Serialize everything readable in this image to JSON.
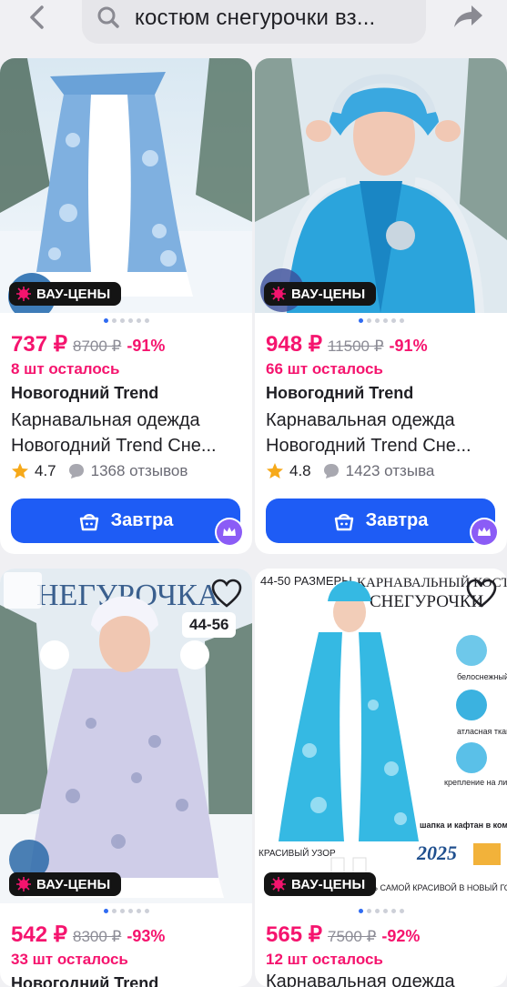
{
  "search": {
    "query": "костюм снегурочки вз..."
  },
  "badge_label": "ВАУ-ЦЕНЫ",
  "products": [
    {
      "price": "737 ₽",
      "old_price": "8700 ₽",
      "discount": "-91%",
      "stock": "8 шт осталось",
      "brand": "Новогодний Trend",
      "title_line1": "Карнавальная одежда",
      "title_line2": "Новогодний Trend Сне...",
      "rating": "4.7",
      "reviews": "1368 отзывов",
      "buy_label": "Завтра",
      "dots": 6,
      "active_dot": 0
    },
    {
      "price": "948 ₽",
      "old_price": "11500 ₽",
      "discount": "-91%",
      "stock": "66 шт осталось",
      "brand": "Новогодний Trend",
      "title_line1": "Карнавальная одежда",
      "title_line2": "Новогодний Trend Сне...",
      "rating": "4.8",
      "reviews": "1423 отзыва",
      "buy_label": "Завтра",
      "dots": 6,
      "active_dot": 0
    },
    {
      "price": "542 ₽",
      "old_price": "8300 ₽",
      "discount": "-93%",
      "stock": "33 шт осталось",
      "brand": "Новогодний Trend",
      "size_tag": "44-56",
      "photo_text": "НЕГУРОЧКА",
      "dots": 6,
      "active_dot": 0
    },
    {
      "price": "565 ₽",
      "old_price": "7500 ₽",
      "discount": "-92%",
      "stock": "12 шт осталось",
      "title_line1": "Карнавальная одежда",
      "photo_text": {
        "sizes": "44-50 РАЗМЕРЫ",
        "heading1": "КАРНАВАЛЬНЫЙ КОСТЮМ",
        "heading2": "СНЕГУРОЧКИ",
        "feat1": "белоснежный мех",
        "feat2": "атласная ткань",
        "feat3": "крепление на липучках",
        "kit": "шапка и кафтан в комплекте",
        "year": "2025",
        "pattern": "КРАСИВЫЙ УЗОР",
        "slogan": "БУДЬ САМОЙ КРАСИВОЙ В НОВЫЙ ГОД"
      },
      "dots": 6,
      "active_dot": 0
    }
  ],
  "colors": {
    "accent_pink": "#f5146e",
    "button_blue": "#1e5cf5",
    "dot_active": "#2f6bf2"
  },
  "icons": [
    "back-arrow-icon",
    "search-icon",
    "share-icon",
    "star-icon",
    "chat-bubble-icon",
    "basket-icon",
    "crown-icon",
    "heart-icon",
    "sparkle-icon"
  ]
}
